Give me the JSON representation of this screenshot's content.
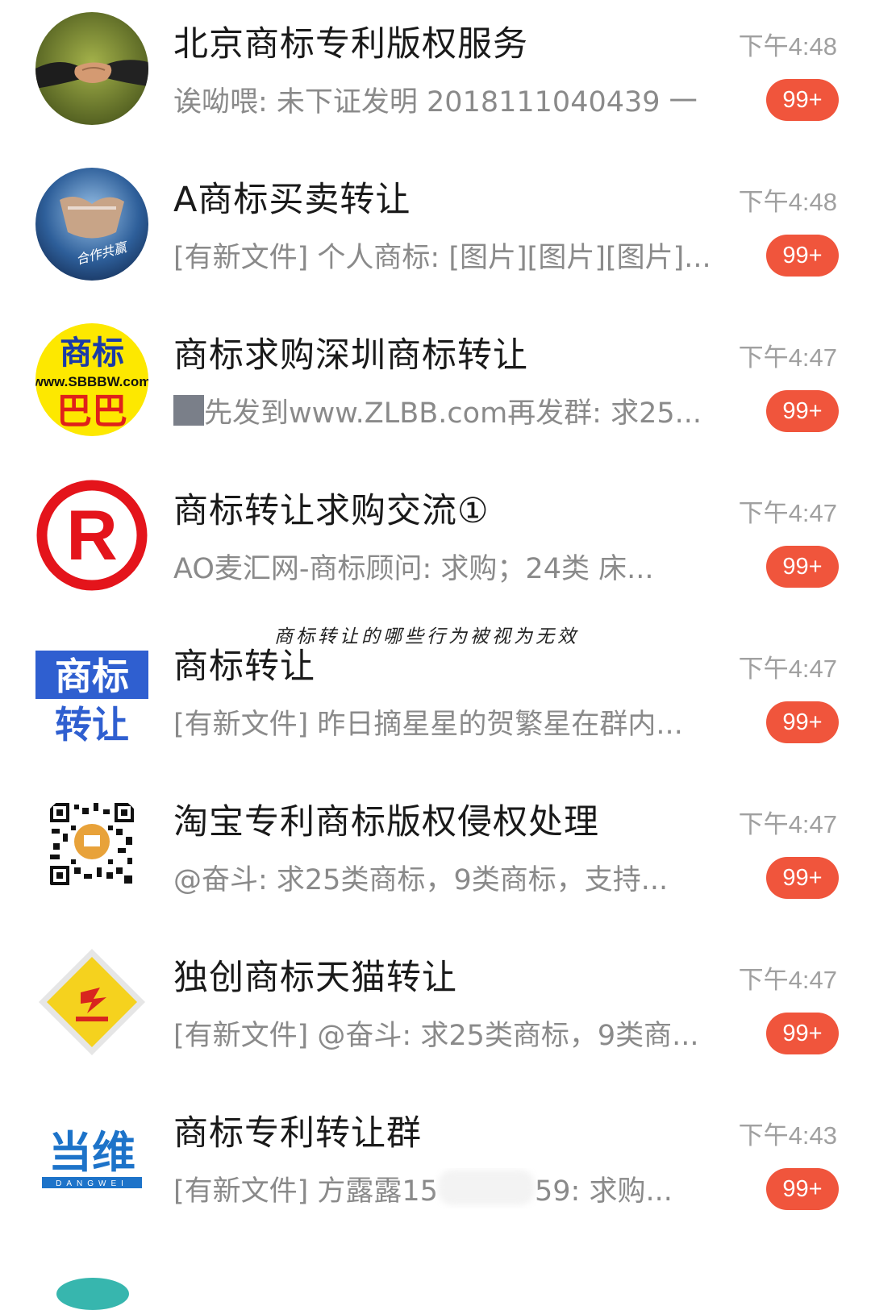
{
  "chats": [
    {
      "name": "北京商标专利版权服务",
      "preview": "诶呦喂: 未下证发明 2018111040439 一",
      "time": "下午4:48",
      "badge": "99+",
      "avatar_icon": "handshake-avatar"
    },
    {
      "name": "A商标买卖转让",
      "preview": "[有新文件] 个人商标: [图片][图片][图片]...",
      "time": "下午4:48",
      "badge": "99+",
      "avatar_icon": "cooperation-avatar",
      "avatar_text": "合作共赢"
    },
    {
      "name": "商标求购深圳商标转让",
      "preview": "先发到www.ZLBB.com再发群: 求25...",
      "time": "下午4:47",
      "badge": "99+",
      "avatar_icon": "sbbbw-logo-avatar",
      "avatar_text_top": "商标",
      "avatar_text_mid": "www.SBBBW.com",
      "avatar_text_bottom": "巴巴"
    },
    {
      "name": "商标转让求购交流①",
      "preview": "AO麦汇网-商标顾问: 求购；24类  床...",
      "time": "下午4:47",
      "badge": "99+",
      "avatar_icon": "registered-mark-avatar",
      "avatar_text": "R"
    },
    {
      "name": "商标转让",
      "preview": "[有新文件] 昨日摘星星的贺繁星在群内...",
      "time": "下午4:47",
      "badge": "99+",
      "avatar_icon": "trademark-transfer-avatar",
      "avatar_text_top": "商标",
      "avatar_text_bottom": "转让"
    },
    {
      "name": "淘宝专利商标版权侵权处理",
      "preview": "@奋斗: 求25类商标，9类商标，支持...",
      "time": "下午4:47",
      "badge": "99+",
      "avatar_icon": "qr-code-avatar"
    },
    {
      "name": "独创商标天猫转让",
      "preview": "[有新文件] @奋斗: 求25类商标，9类商...",
      "time": "下午4:47",
      "badge": "99+",
      "avatar_icon": "diamond-logo-avatar"
    },
    {
      "name": "商标专利转让群",
      "preview_a": "[有新文件] 方露露15",
      "preview_b": "59: 求购...",
      "time": "下午4:43",
      "badge": "99+",
      "avatar_icon": "dangwei-logo-avatar",
      "avatar_text": "当维",
      "avatar_subtext": "DANGWEI"
    }
  ],
  "overlay_caption": "商标转让的哪些行为被视为无效",
  "colors": {
    "badge": "#f0553c",
    "name": "#1a1a1a",
    "preview": "#8a8a8a",
    "time": "#a0a0a0"
  }
}
